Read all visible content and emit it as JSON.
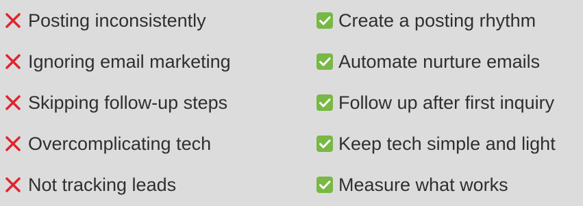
{
  "colors": {
    "background": "#dcdcdc",
    "text": "#2f2f2f",
    "cross": "#e0242f",
    "check_bg": "#78b845",
    "check_mark": "#ffffff"
  },
  "icons": {
    "mistake": "cross-icon",
    "fix": "check-icon"
  },
  "mistakes": [
    {
      "label": "Posting inconsistently"
    },
    {
      "label": "Ignoring email marketing"
    },
    {
      "label": "Skipping follow-up steps"
    },
    {
      "label": "Overcomplicating tech"
    },
    {
      "label": "Not tracking leads"
    }
  ],
  "fixes": [
    {
      "label": "Create a posting rhythm"
    },
    {
      "label": "Automate nurture emails"
    },
    {
      "label": "Follow up after first inquiry"
    },
    {
      "label": "Keep tech simple and light"
    },
    {
      "label": "Measure what works"
    }
  ]
}
